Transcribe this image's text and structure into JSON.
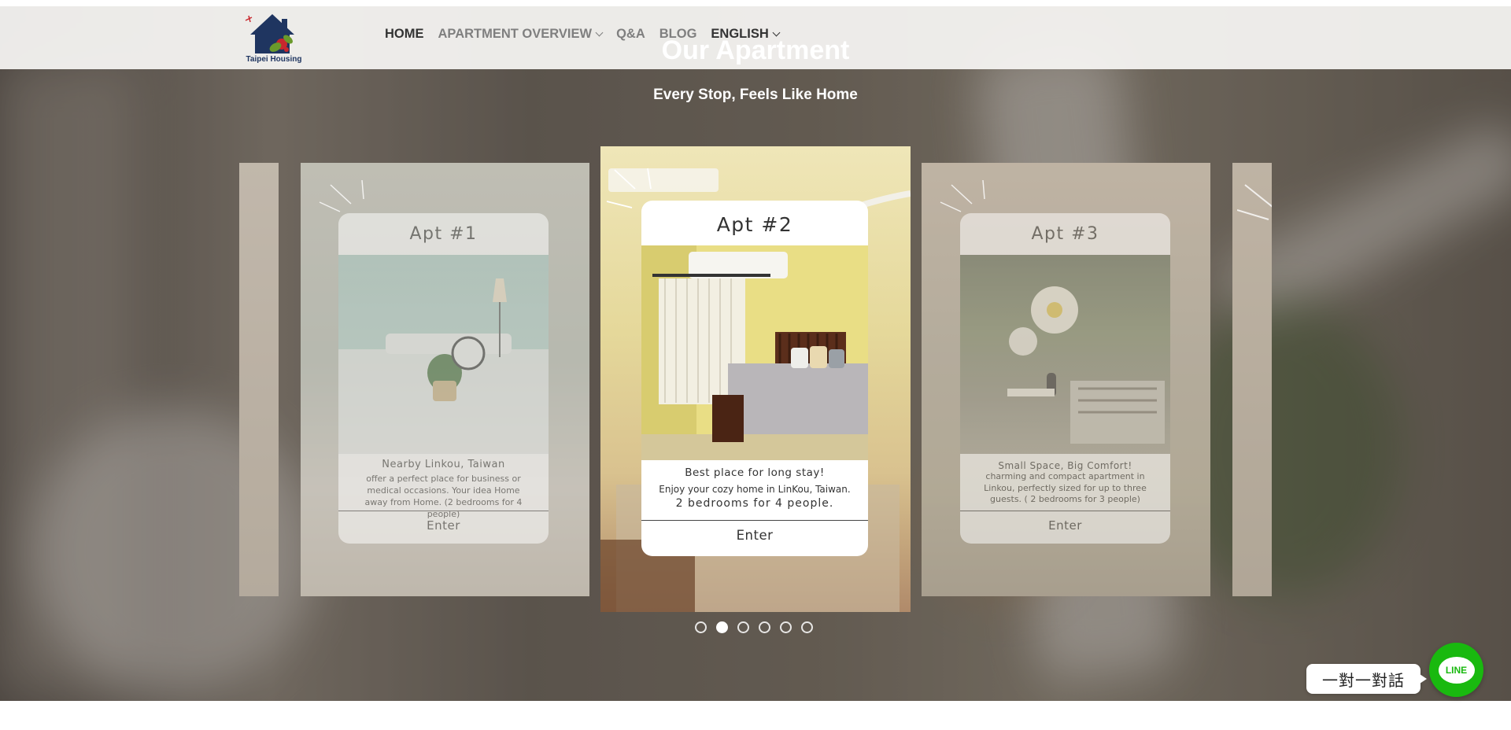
{
  "site": {
    "logo_text": "Taipei Housing"
  },
  "nav": {
    "items": [
      {
        "label": "HOME",
        "active": true,
        "dropdown": false
      },
      {
        "label": "APARTMENT OVERVIEW",
        "active": false,
        "dropdown": true
      },
      {
        "label": "Q&A",
        "active": false,
        "dropdown": false
      },
      {
        "label": "BLOG",
        "active": false,
        "dropdown": false
      },
      {
        "label": "ENGLISH",
        "active": true,
        "dropdown": true
      }
    ]
  },
  "hero": {
    "title": "Our Apartment",
    "subtitle": "Every Stop, Feels Like Home"
  },
  "apartments": [
    {
      "title": "Apt #1",
      "heading": "Nearby Linkou, Taiwan",
      "body": "offer a perfect place for business or medical occasions. Your idea Home away from Home. (2 bedrooms for 4 people)",
      "button": "Enter"
    },
    {
      "title": "Apt #2",
      "heading": "Best place for long stay!",
      "body": "Enjoy your cozy home in LinKou, Taiwan.",
      "extra": "2 bedrooms for 4 people.",
      "button": "Enter"
    },
    {
      "title": "Apt #3",
      "heading": "Small Space, Big Comfort!",
      "body": "charming and compact apartment in Linkou, perfectly sized for up to three guests. ( 2 bedrooms for 3 people)",
      "button": "Enter"
    }
  ],
  "carousel": {
    "total_slides": 6,
    "active_index": 1
  },
  "chat": {
    "label": "一對一對話",
    "button_text": "LINE"
  },
  "colors": {
    "line_green": "#19b90f",
    "nav_active": "#333333",
    "nav_inactive": "#7f7f7f",
    "logo_blue": "#1f3560"
  }
}
